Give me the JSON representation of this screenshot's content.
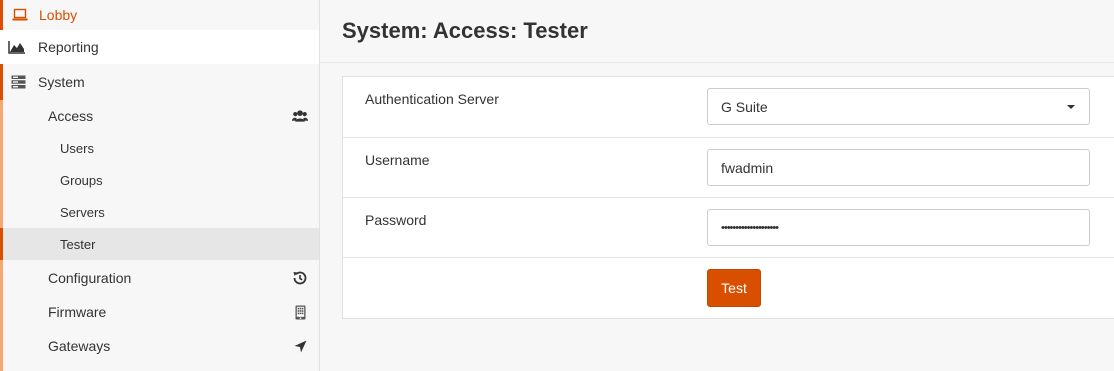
{
  "sidebar": {
    "lobby": {
      "label": "Lobby",
      "icon": "laptop-icon"
    },
    "reporting": {
      "label": "Reporting",
      "icon": "area-chart-icon"
    },
    "system": {
      "label": "System",
      "icon": "server-icon"
    },
    "access": {
      "label": "Access",
      "icon": "users-icon"
    },
    "access_items": {
      "users": "Users",
      "groups": "Groups",
      "servers": "Servers",
      "tester": "Tester"
    },
    "configuration": {
      "label": "Configuration",
      "icon": "history-icon"
    },
    "firmware": {
      "label": "Firmware",
      "icon": "tablet-icon"
    },
    "gateways": {
      "label": "Gateways",
      "icon": "location-arrow-icon"
    }
  },
  "page": {
    "title": "System: Access: Tester"
  },
  "form": {
    "auth_server": {
      "label": "Authentication Server",
      "value": "G Suite"
    },
    "username": {
      "label": "Username",
      "value": "fwadmin"
    },
    "password": {
      "label": "Password",
      "value": "••••••••••••••••••••"
    },
    "test_button": "Test"
  },
  "colors": {
    "accent": "#d94f00",
    "accent_light": "#f3a971",
    "selected_bg": "#e6e6e6"
  }
}
